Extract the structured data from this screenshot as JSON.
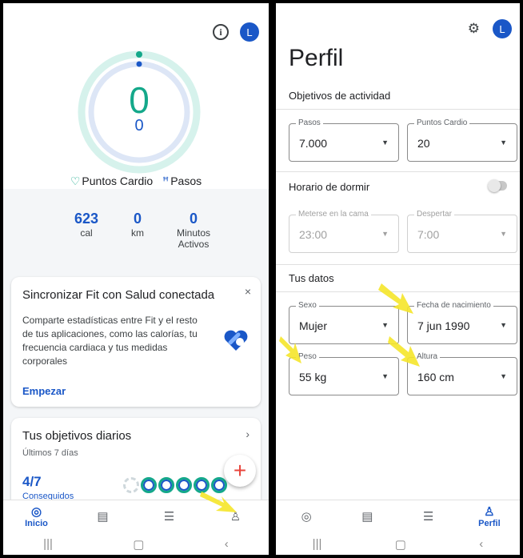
{
  "left": {
    "avatar_letter": "L",
    "ring": {
      "cardio_points": "0",
      "steps": "0"
    },
    "legend": {
      "cardio": "Puntos Cardio",
      "steps": "Pasos"
    },
    "stats": [
      {
        "value": "623",
        "unit": "cal"
      },
      {
        "value": "0",
        "unit": "km"
      },
      {
        "value": "0",
        "unit": "Minutos Activos"
      }
    ],
    "sync_card": {
      "title": "Sincronizar Fit con Salud conectada",
      "description": "Comparte estadísticas entre Fit y el resto de tus aplicaciones, como las calorías, tu frecuencia cardiaca y tus medidas corporales",
      "link": "Empezar",
      "close": "×"
    },
    "goals_card": {
      "title": "Tus objetivos diarios",
      "subtitle": "Últimos 7 días",
      "count": "4/7",
      "count_label": "Conseguidos"
    },
    "fab": "+",
    "nav": [
      {
        "label": "Inicio",
        "icon": "home-ring-icon",
        "active": true
      },
      {
        "label": "",
        "icon": "journal-icon"
      },
      {
        "label": "",
        "icon": "list-icon"
      },
      {
        "label": "",
        "icon": "profile-icon"
      }
    ]
  },
  "right": {
    "avatar_letter": "L",
    "title": "Perfil",
    "activity": {
      "heading": "Objetivos de actividad",
      "steps": {
        "label": "Pasos",
        "value": "7.000"
      },
      "cardio": {
        "label": "Puntos Cardio",
        "value": "20"
      }
    },
    "sleep": {
      "heading": "Horario de dormir",
      "enabled": false,
      "bed": {
        "label": "Meterse en la cama",
        "value": "23:00"
      },
      "wake": {
        "label": "Despertar",
        "value": "7:00"
      }
    },
    "your_data": {
      "heading": "Tus datos",
      "sex": {
        "label": "Sexo",
        "value": "Mujer"
      },
      "birth": {
        "label": "Fecha de nacimiento",
        "value": "7 jun 1990"
      },
      "weight": {
        "label": "Peso",
        "value": "55 kg"
      },
      "height": {
        "label": "Altura",
        "value": "160 cm"
      }
    },
    "nav": [
      {
        "label": "",
        "icon": "home-ring-icon"
      },
      {
        "label": "",
        "icon": "journal-icon"
      },
      {
        "label": "",
        "icon": "list-icon"
      },
      {
        "label": "Perfil",
        "icon": "profile-icon",
        "active": true
      }
    ]
  },
  "colors": {
    "accent_blue": "#1a57c7",
    "accent_teal": "#14a88a",
    "highlight_arrow": "#f5e52a"
  }
}
